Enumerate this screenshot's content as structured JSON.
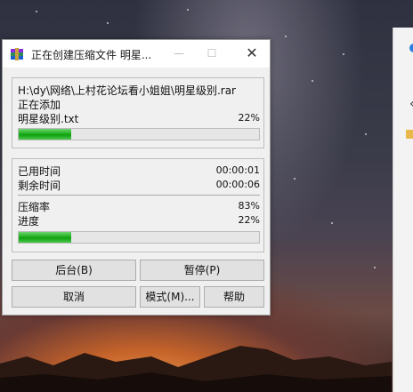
{
  "dialog": {
    "title": "正在创建压缩文件 明星...",
    "archive_path": "H:\\dy\\网络\\上村花论坛看小姐姐\\明星级别.rar",
    "status": "正在添加",
    "current_file": "明星级别.txt",
    "file_percent": "22%",
    "file_progress": 0.22,
    "elapsed_label": "已用时间",
    "elapsed_value": "00:00:01",
    "remaining_label": "剩余时间",
    "remaining_value": "00:00:06",
    "ratio_label": "压缩率",
    "ratio_value": "83%",
    "progress_label": "进度",
    "progress_value": "22%",
    "total_progress": 0.22,
    "buttons": {
      "background": "后台(B)",
      "pause": "暂停(P)",
      "cancel": "取消",
      "mode": "模式(M)...",
      "help": "帮助"
    }
  },
  "icons": [
    "winrar-icon",
    "minimize-icon",
    "maximize-icon",
    "close-icon",
    "folder-icon"
  ],
  "colors": {
    "progress_fill": "#20b020",
    "window_bg": "#f0f0f0"
  }
}
